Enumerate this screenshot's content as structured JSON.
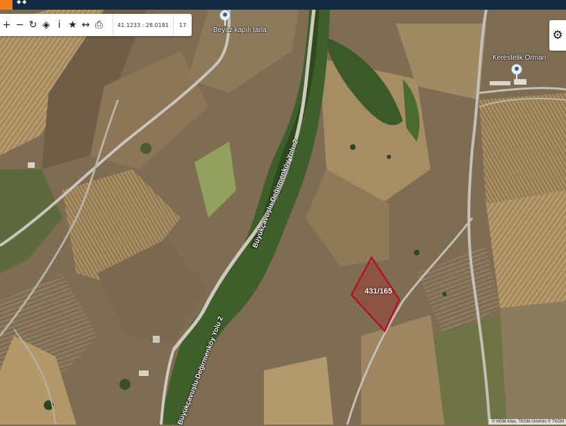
{
  "topbar": {
    "icon": "map-logo-icon"
  },
  "toolbar": {
    "tools": [
      {
        "name": "zoom-in-button",
        "glyph": "+",
        "icon": "plus-icon"
      },
      {
        "name": "zoom-out-button",
        "glyph": "−",
        "icon": "minus-icon"
      },
      {
        "name": "refresh-button",
        "glyph": "↻",
        "icon": "refresh-icon"
      },
      {
        "name": "location-button",
        "glyph": "◈",
        "icon": "location-icon"
      },
      {
        "name": "info-button",
        "glyph": "i",
        "icon": "info-icon"
      },
      {
        "name": "favorite-button",
        "glyph": "★",
        "icon": "star-icon"
      },
      {
        "name": "measure-button",
        "glyph": "↔",
        "icon": "measure-icon"
      },
      {
        "name": "print-button",
        "glyph": "⎙",
        "icon": "print-icon"
      }
    ],
    "coordinates": "41.1233 : 28.0181",
    "zoom_level": "17"
  },
  "settings": {
    "icon": "gear-icon"
  },
  "places": [
    {
      "label": "Beyaz kapılı tarla",
      "icon": "place-pin-icon"
    },
    {
      "label": "Kerestelik Orman",
      "icon": "place-pin-icon"
    }
  ],
  "roads": [
    {
      "label": "Büyükçavuşlu-Değirmenköy Yolu 2"
    },
    {
      "label": "Büyükçavuşlu-Değirmenköy Yolu 2"
    }
  ],
  "parcel": {
    "label": "431/165",
    "outline_color": "#b0151d"
  },
  "attribution": "© HGM Atlas, TKGM Ortofoto © TKGM"
}
